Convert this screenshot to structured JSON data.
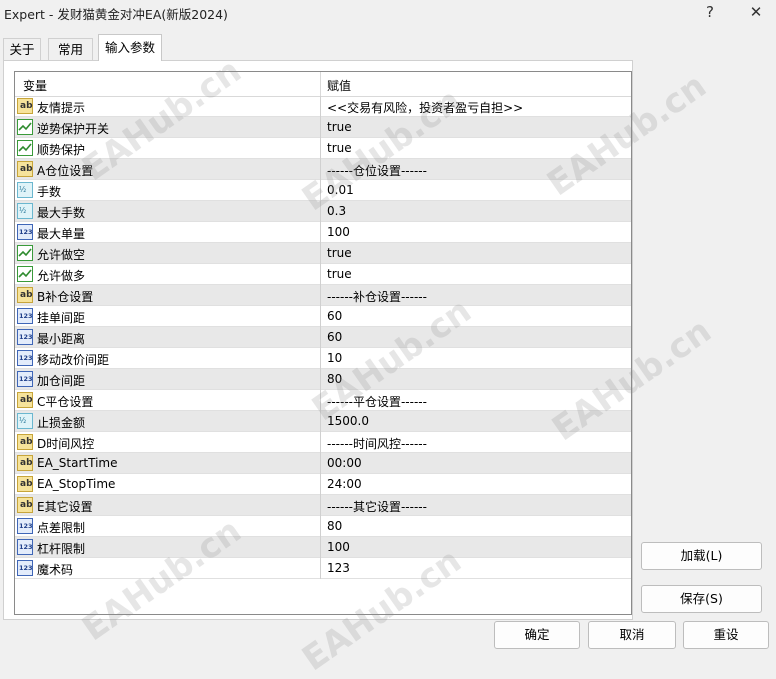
{
  "window": {
    "title": "Expert - 发财猫黄金对冲EA(新版2024)",
    "help_label": "?",
    "close_label": "✕"
  },
  "tabs": [
    {
      "label": "关于"
    },
    {
      "label": "常用"
    },
    {
      "label": "输入参数"
    }
  ],
  "grid": {
    "header": {
      "name": "变量",
      "value": "赋值"
    },
    "rows": [
      {
        "type": "string",
        "name": "友情提示",
        "value": "<<交易有风险，投资者盈亏自担>>"
      },
      {
        "type": "bool",
        "name": "逆势保护开关",
        "value": "true"
      },
      {
        "type": "bool",
        "name": "顺势保护",
        "value": "true"
      },
      {
        "type": "string",
        "name": "A仓位设置",
        "value": "------仓位设置------"
      },
      {
        "type": "double",
        "name": "手数",
        "value": "0.01"
      },
      {
        "type": "double",
        "name": "最大手数",
        "value": "0.3"
      },
      {
        "type": "int",
        "name": "最大单量",
        "value": "100"
      },
      {
        "type": "bool",
        "name": "允许做空",
        "value": "true"
      },
      {
        "type": "bool",
        "name": "允许做多",
        "value": "true"
      },
      {
        "type": "string",
        "name": "B补仓设置",
        "value": "------补仓设置------"
      },
      {
        "type": "int",
        "name": "挂单间距",
        "value": "60"
      },
      {
        "type": "int",
        "name": "最小距离",
        "value": "60"
      },
      {
        "type": "int",
        "name": "移动改价间距",
        "value": "10"
      },
      {
        "type": "int",
        "name": "加仓间距",
        "value": "80"
      },
      {
        "type": "string",
        "name": "C平仓设置",
        "value": "------平仓设置------"
      },
      {
        "type": "double",
        "name": "止损金额",
        "value": "1500.0"
      },
      {
        "type": "string",
        "name": "D时间风控",
        "value": "------时间风控------"
      },
      {
        "type": "string",
        "name": "EA_StartTime",
        "value": "00:00"
      },
      {
        "type": "string",
        "name": "EA_StopTime",
        "value": "24:00"
      },
      {
        "type": "string",
        "name": "E其它设置",
        "value": "------其它设置------"
      },
      {
        "type": "int",
        "name": "点差限制",
        "value": "80"
      },
      {
        "type": "int",
        "name": "杠杆限制",
        "value": "100"
      },
      {
        "type": "int",
        "name": "魔术码",
        "value": "123"
      }
    ]
  },
  "icons": {
    "string": "ab",
    "double": "½",
    "int": "123",
    "bool": "checkmark-icon"
  },
  "buttons": {
    "load": "加载(L)",
    "save": "保存(S)",
    "ok": "确定",
    "cancel": "取消",
    "reset": "重设"
  },
  "watermark": "EAHub.cn",
  "colors": {
    "alt_row": "#e8e8e8",
    "grid_border": "#8a8a8a",
    "bool_icon": "#3a9a3a",
    "int_icon": "#3f66b7",
    "string_icon": "#f6e39b"
  }
}
